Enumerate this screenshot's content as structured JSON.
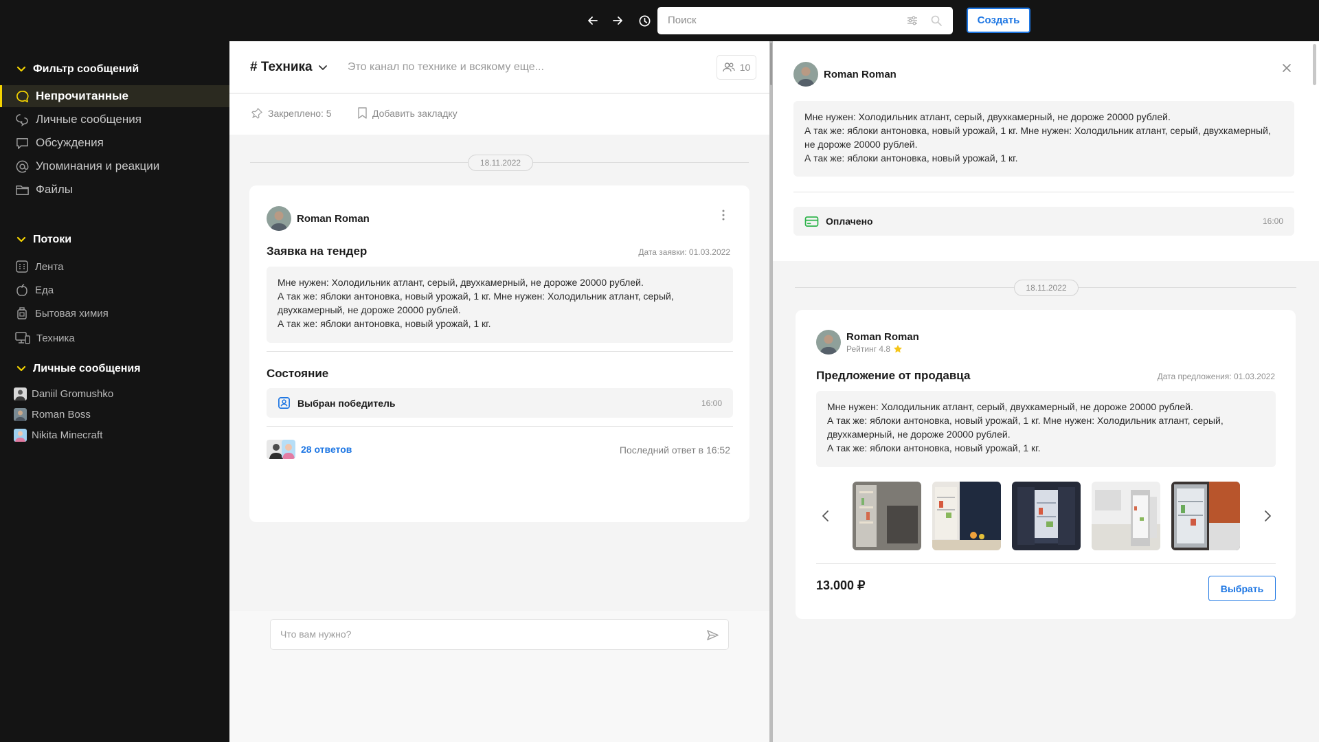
{
  "colors": {
    "accent": "#1d76e3",
    "sidebar_bg": "#141414",
    "active_marker": "#f5d400",
    "paid_green": "#2db34a"
  },
  "topbar": {
    "search_placeholder": "Поиск",
    "create_label": "Создать",
    "icons": [
      "arrow-left-icon",
      "arrow-right-icon",
      "history-icon",
      "filter-icon",
      "search-icon"
    ]
  },
  "sidebar": {
    "filter_title": "Фильтр сообщений",
    "filter_items": [
      {
        "label": "Непрочитанные",
        "icon": "chat-bubble-icon",
        "active": true
      },
      {
        "label": "Личные сообщения",
        "icon": "chats-icon"
      },
      {
        "label": "Обсуждения",
        "icon": "comment-icon"
      },
      {
        "label": "Упоминания и реакции",
        "icon": "at-icon"
      },
      {
        "label": "Файлы",
        "icon": "folder-icon"
      }
    ],
    "streams_title": "Потоки",
    "streams": [
      {
        "label": "Лента",
        "icon": "feed-icon"
      },
      {
        "label": "Еда",
        "icon": "apple-icon"
      },
      {
        "label": "Бытовая химия",
        "icon": "bottle-icon"
      },
      {
        "label": "Техника",
        "icon": "devices-icon"
      }
    ],
    "dm_title": "Личные сообщения",
    "dms": [
      {
        "name": "Daniil Gromushko"
      },
      {
        "name": "Roman Boss"
      },
      {
        "name": "Nikita Minecraft"
      }
    ]
  },
  "channel": {
    "title": "# Техника",
    "description": "Это канал по технике и всякому еще...",
    "members_count": "10",
    "pinned": "Закреплено: 5",
    "add_bookmark": "Добавить закладку",
    "date": "18.11.2022",
    "post": {
      "author": "Roman Roman",
      "title": "Заявка на тендер",
      "date_meta": "Дата заявки: 01.03.2022",
      "body": [
        "Мне нужен: Холодильник атлант, серый, двухкамерный, не дороже 20000 рублей.",
        "А так же: яблоки антоновка, новый урожай, 1 кг. Мне нужен: Холодильник атлант, серый,",
        "двухкамерный, не дороже 20000 рублей.",
        "А так же: яблоки антоновка, новый урожай, 1 кг."
      ],
      "state_title": "Состояние",
      "state_label": "Выбран победитель",
      "state_time": "16:00",
      "replies": "28 ответов",
      "last_reply": "Последний ответ в 16:52"
    },
    "compose_placeholder": "Что вам нужно?"
  },
  "thread": {
    "author": "Roman Roman",
    "body": [
      "Мне нужен: Холодильник атлант, серый, двухкамерный, не дороже 20000 рублей.",
      "А так же: яблоки антоновка, новый урожай, 1 кг. Мне нужен: Холодильник атлант, серый, двухкамерный,",
      "не дороже 20000 рублей.",
      "А так же: яблоки антоновка, новый урожай, 1 кг."
    ],
    "paid_label": "Оплачено",
    "paid_time": "16:00",
    "date": "18.11.2022",
    "offer": {
      "author": "Roman Roman",
      "rating": "Рейтинг 4.8",
      "title": "Предложение от продавца",
      "date_meta": "Дата предложения: 01.03.2022",
      "body": [
        "Мне нужен: Холодильник атлант, серый, двухкамерный, не дороже 20000 рублей.",
        "А так же: яблоки антоновка, новый урожай, 1 кг. Мне нужен: Холодильник атлант, серый,",
        "двухкамерный, не дороже 20000 рублей.",
        "А так же: яблоки антоновка, новый урожай, 1 кг."
      ],
      "price": "13.000 ₽",
      "choose_label": "Выбрать"
    }
  }
}
